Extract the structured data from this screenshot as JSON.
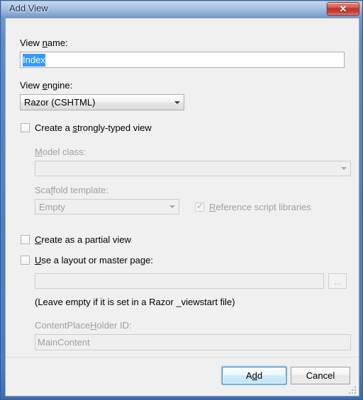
{
  "window": {
    "title": "Add View",
    "close_glyph": "✕",
    "close_label": "Close"
  },
  "form": {
    "view_name": {
      "label_pre": "View ",
      "label_acc": "n",
      "label_post": "ame:",
      "value": "Index"
    },
    "view_engine": {
      "label_pre": "View ",
      "label_acc": "e",
      "label_post": "ngine:",
      "value": "Razor (CSHTML)"
    },
    "strongly_typed": {
      "label_pre": "Create a ",
      "label_acc": "s",
      "label_post": "trongly-typed view",
      "checked": false
    },
    "model_class": {
      "label_pre": "",
      "label_acc": "M",
      "label_post": "odel class:",
      "value": ""
    },
    "scaffold_template": {
      "label_pre": "Sca",
      "label_acc": "f",
      "label_post": "fold template:",
      "value": "Empty"
    },
    "reference_script_libraries": {
      "label_pre": "",
      "label_acc": "R",
      "label_post": "eference script libraries",
      "checked": true,
      "check_glyph": "✓"
    },
    "partial_view": {
      "label_pre": "",
      "label_acc": "C",
      "label_post": "reate as a partial view",
      "checked": false
    },
    "use_layout": {
      "label_pre": "",
      "label_acc": "U",
      "label_post": "se a layout or master page:",
      "checked": false
    },
    "layout_path": {
      "value": ""
    },
    "browse_button": {
      "label": "..."
    },
    "layout_hint": "(Leave empty if it is set in a Razor _viewstart file)",
    "content_placeholder": {
      "label_pre": "ContentPlace",
      "label_acc": "H",
      "label_post": "older ID:",
      "value": "MainContent"
    }
  },
  "buttons": {
    "add_pre": "A",
    "add_acc": "d",
    "add_post": "d",
    "cancel": "Cancel"
  },
  "colors": {
    "accent": "#3399ff",
    "title_frame": "#4f7fc0",
    "close_red": "#ba3327",
    "disabled_text": "#a0a0a0"
  }
}
